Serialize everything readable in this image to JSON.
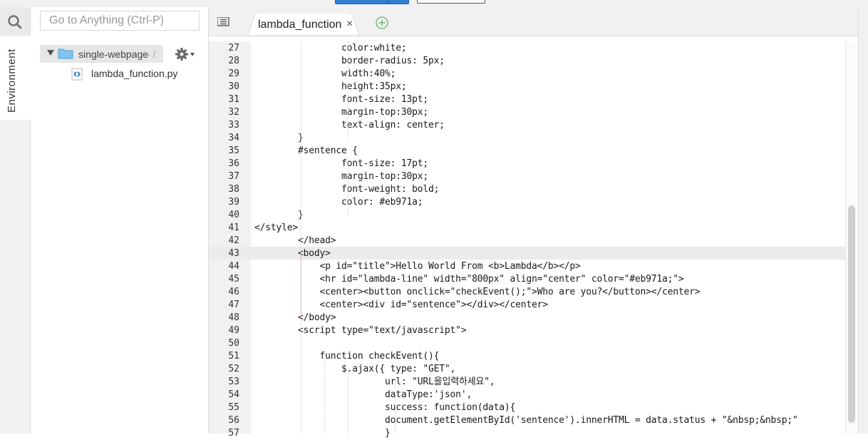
{
  "sidebar": {
    "environment_label": "Environment",
    "search_placeholder": "Go to Anything (Ctrl-P)",
    "tree": {
      "folder_name": "single-webpage",
      "folder_suffix": "- /",
      "file_name": "lambda_function.py"
    }
  },
  "editor": {
    "tab_label": "lambda_function",
    "tab_close": "×",
    "active_line": 43,
    "lines": [
      {
        "n": "27",
        "text": "                color:white;"
      },
      {
        "n": "28",
        "text": "                border-radius: 5px;"
      },
      {
        "n": "29",
        "text": "                width:40%;"
      },
      {
        "n": "30",
        "text": "                height:35px;"
      },
      {
        "n": "31",
        "text": "                font-size: 13pt;"
      },
      {
        "n": "32",
        "text": "                margin-top:30px;"
      },
      {
        "n": "33",
        "text": "                text-align: center;"
      },
      {
        "n": "34",
        "text": "        }"
      },
      {
        "n": "35",
        "text": "        #sentence {"
      },
      {
        "n": "36",
        "text": "                font-size: 17pt;"
      },
      {
        "n": "37",
        "text": "                margin-top:30px;"
      },
      {
        "n": "38",
        "text": "                font-weight: bold;"
      },
      {
        "n": "39",
        "text": "                color: #eb971a;"
      },
      {
        "n": "40",
        "text": "        }"
      },
      {
        "n": "41",
        "text": "</style>"
      },
      {
        "n": "42",
        "text": "        </head>"
      },
      {
        "n": "43",
        "text": "        <body>"
      },
      {
        "n": "44",
        "text": "            <p id=\"title\">Hello World From <b>Lambda</b></p>"
      },
      {
        "n": "45",
        "text": "            <hr id=\"lambda-line\" width=\"800px\" align=\"center\" color=\"#eb971a;\">"
      },
      {
        "n": "46",
        "text": "            <center><button onclick=\"checkEvent();\">Who are you?</button></center>"
      },
      {
        "n": "47",
        "text": "            <center><div id=\"sentence\"></div></center>"
      },
      {
        "n": "48",
        "text": "        </body>"
      },
      {
        "n": "49",
        "text": "        <script type=\"text/javascript\">"
      },
      {
        "n": "50",
        "text": ""
      },
      {
        "n": "51",
        "text": "            function checkEvent(){"
      },
      {
        "n": "52",
        "text": "                $.ajax({ type: \"GET\","
      },
      {
        "n": "53",
        "text": "                        url: \"URL을입력하세요\","
      },
      {
        "n": "54",
        "text": "                        dataType:'json',"
      },
      {
        "n": "55",
        "text": "                        success: function(data){"
      },
      {
        "n": "56",
        "text": "                        document.getElementById('sentence').innerHTML = data.status + \"&nbsp;&nbsp;\""
      },
      {
        "n": "57",
        "text": "                        }"
      }
    ]
  },
  "colors": {
    "accent": "#2f7fd1",
    "plus": "#5cb85c",
    "active_line_bg": "#ebebeb"
  },
  "icons": [
    "search-icon",
    "folder-icon",
    "gear-icon",
    "python-file-icon",
    "tab-menu-icon",
    "add-tab-icon",
    "close-icon"
  ]
}
